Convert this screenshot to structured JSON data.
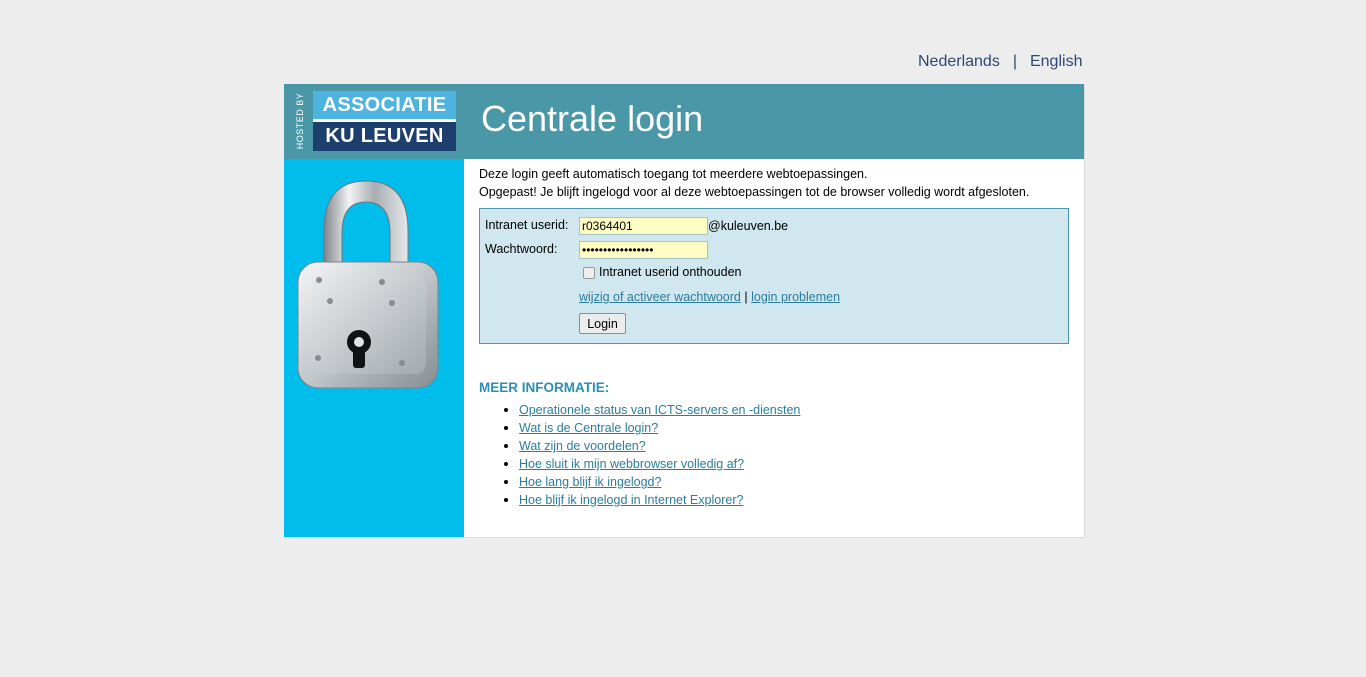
{
  "language": {
    "dutch": "Nederlands",
    "separator": "|",
    "english": "English"
  },
  "header": {
    "hosted_by": "HOSTED BY",
    "logo_top": "ASSOCIATIE",
    "logo_bottom": "KU LEUVEN",
    "title": "Centrale login"
  },
  "intro": {
    "line1": "Deze login geeft automatisch toegang tot meerdere webtoepassingen.",
    "line2": "Opgepast! Je blijft ingelogd voor al deze webtoepassingen tot de browser volledig wordt afgesloten."
  },
  "login": {
    "userid_label": "Intranet userid:",
    "userid_value": "r0364401",
    "userid_suffix": "@kuleuven.be",
    "password_label": "Wachtwoord:",
    "password_value": "•••••••••••••••••",
    "remember_label": "Intranet userid onthouden",
    "link_change_password": "wijzig of activeer wachtwoord",
    "link_separator": "|",
    "link_problems": "login problemen",
    "button_label": "Login"
  },
  "more_info": {
    "heading": "MEER INFORMATIE:",
    "items": [
      "Operationele status van ICTS-servers en -diensten",
      "Wat is de Centrale login?",
      "Wat zijn de voordelen?",
      "Hoe sluit ik mijn webbrowser volledig af?",
      "Hoe lang blijf ik ingelogd?",
      "Hoe blijf ik ingelogd in Internet Explorer?"
    ]
  },
  "colors": {
    "background": "#ededed",
    "header": "#4a97a7",
    "sidebar": "#00bdeb",
    "login_box": "#d0e7ef",
    "input_fill": "#fdfdc4",
    "link": "#2a7d9e",
    "heading": "#2a8fb4",
    "logo_top": "#4fb3df",
    "logo_bottom": "#1d3f6e"
  },
  "icons": {
    "padlock": "padlock-icon",
    "checkbox": "checkbox"
  }
}
